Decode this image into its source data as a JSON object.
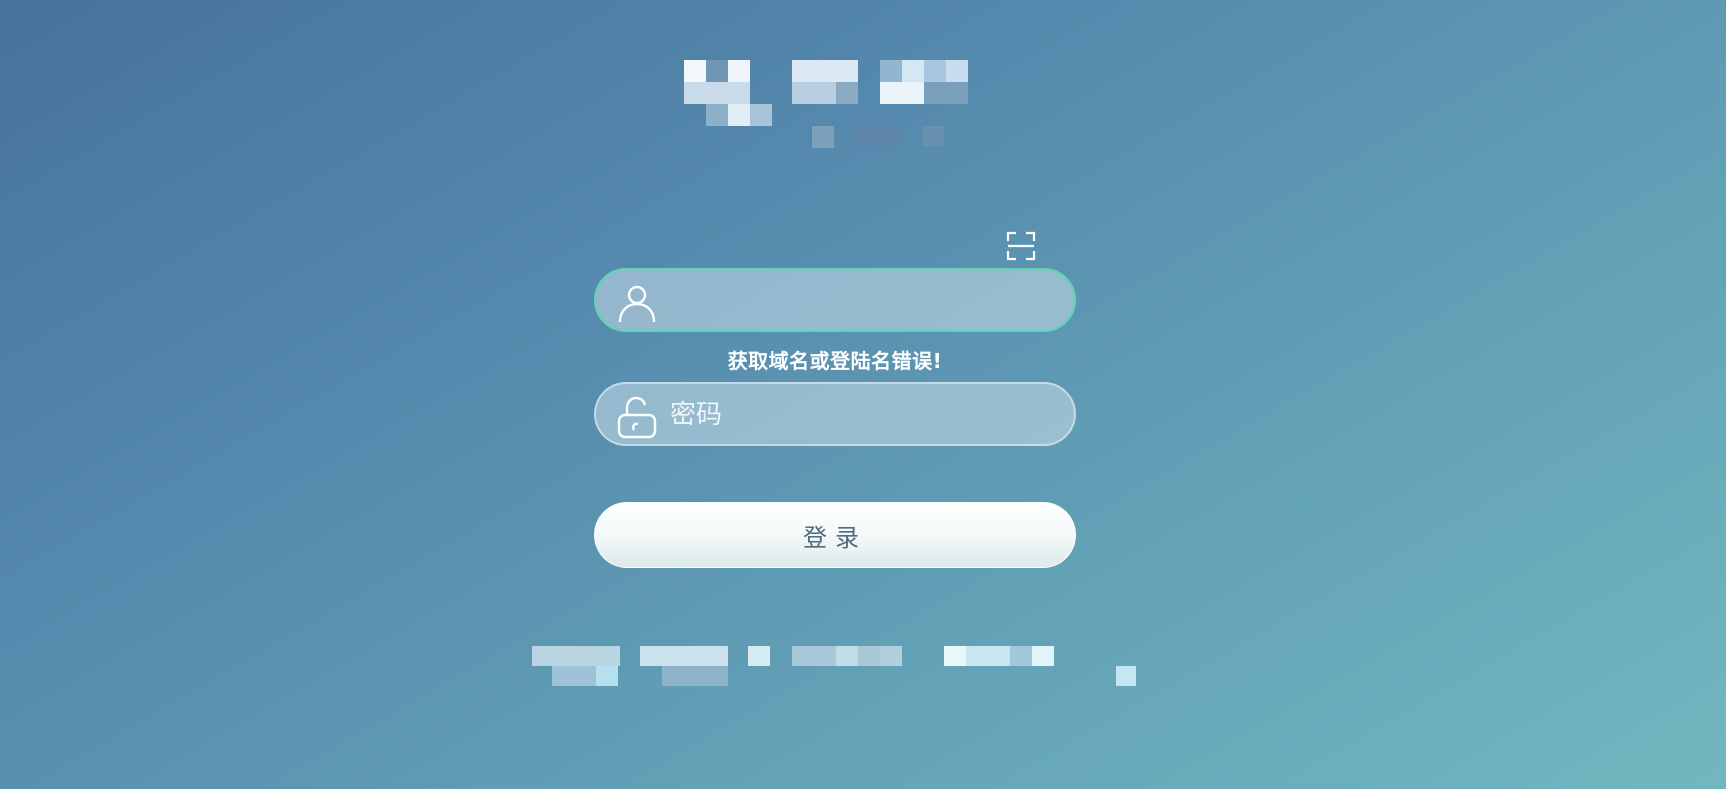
{
  "login_form": {
    "username": {
      "value": "",
      "placeholder": "",
      "icon": "user-icon",
      "border_color": "#5cd6b6"
    },
    "error_message": "获取域名或登陆名错误!",
    "password": {
      "value": "",
      "placeholder": "密码",
      "icon": "unlock-icon"
    },
    "submit_label": "登录",
    "scan_icon": "scan-icon"
  }
}
